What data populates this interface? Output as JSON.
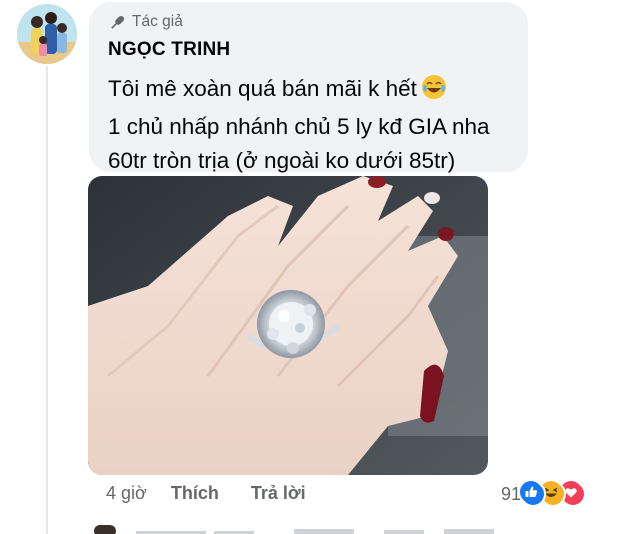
{
  "comment": {
    "badge_label": "Tác giả",
    "author_name": "NGỌC TRINH",
    "lines": [
      "Tôi mê xoàn quá bán mãi k hết",
      "1 chủ nhấp nhánh chủ 5 ly kđ GIA nha",
      "60tr tròn trịa (ở ngoài ko dưới 85tr)"
    ],
    "emoji": "face-with-tears-of-joy-icon"
  },
  "photo": {
    "subject": "hand wearing diamond cluster ring"
  },
  "actions": {
    "time": "4 giờ",
    "like": "Thích",
    "reply": "Trả lời"
  },
  "reactions": {
    "count": "91",
    "icons": [
      "like-icon",
      "haha-icon",
      "love-icon"
    ],
    "colors": {
      "like": "#1877f2",
      "haha": "#f7b125",
      "love": "#f33e58"
    }
  }
}
